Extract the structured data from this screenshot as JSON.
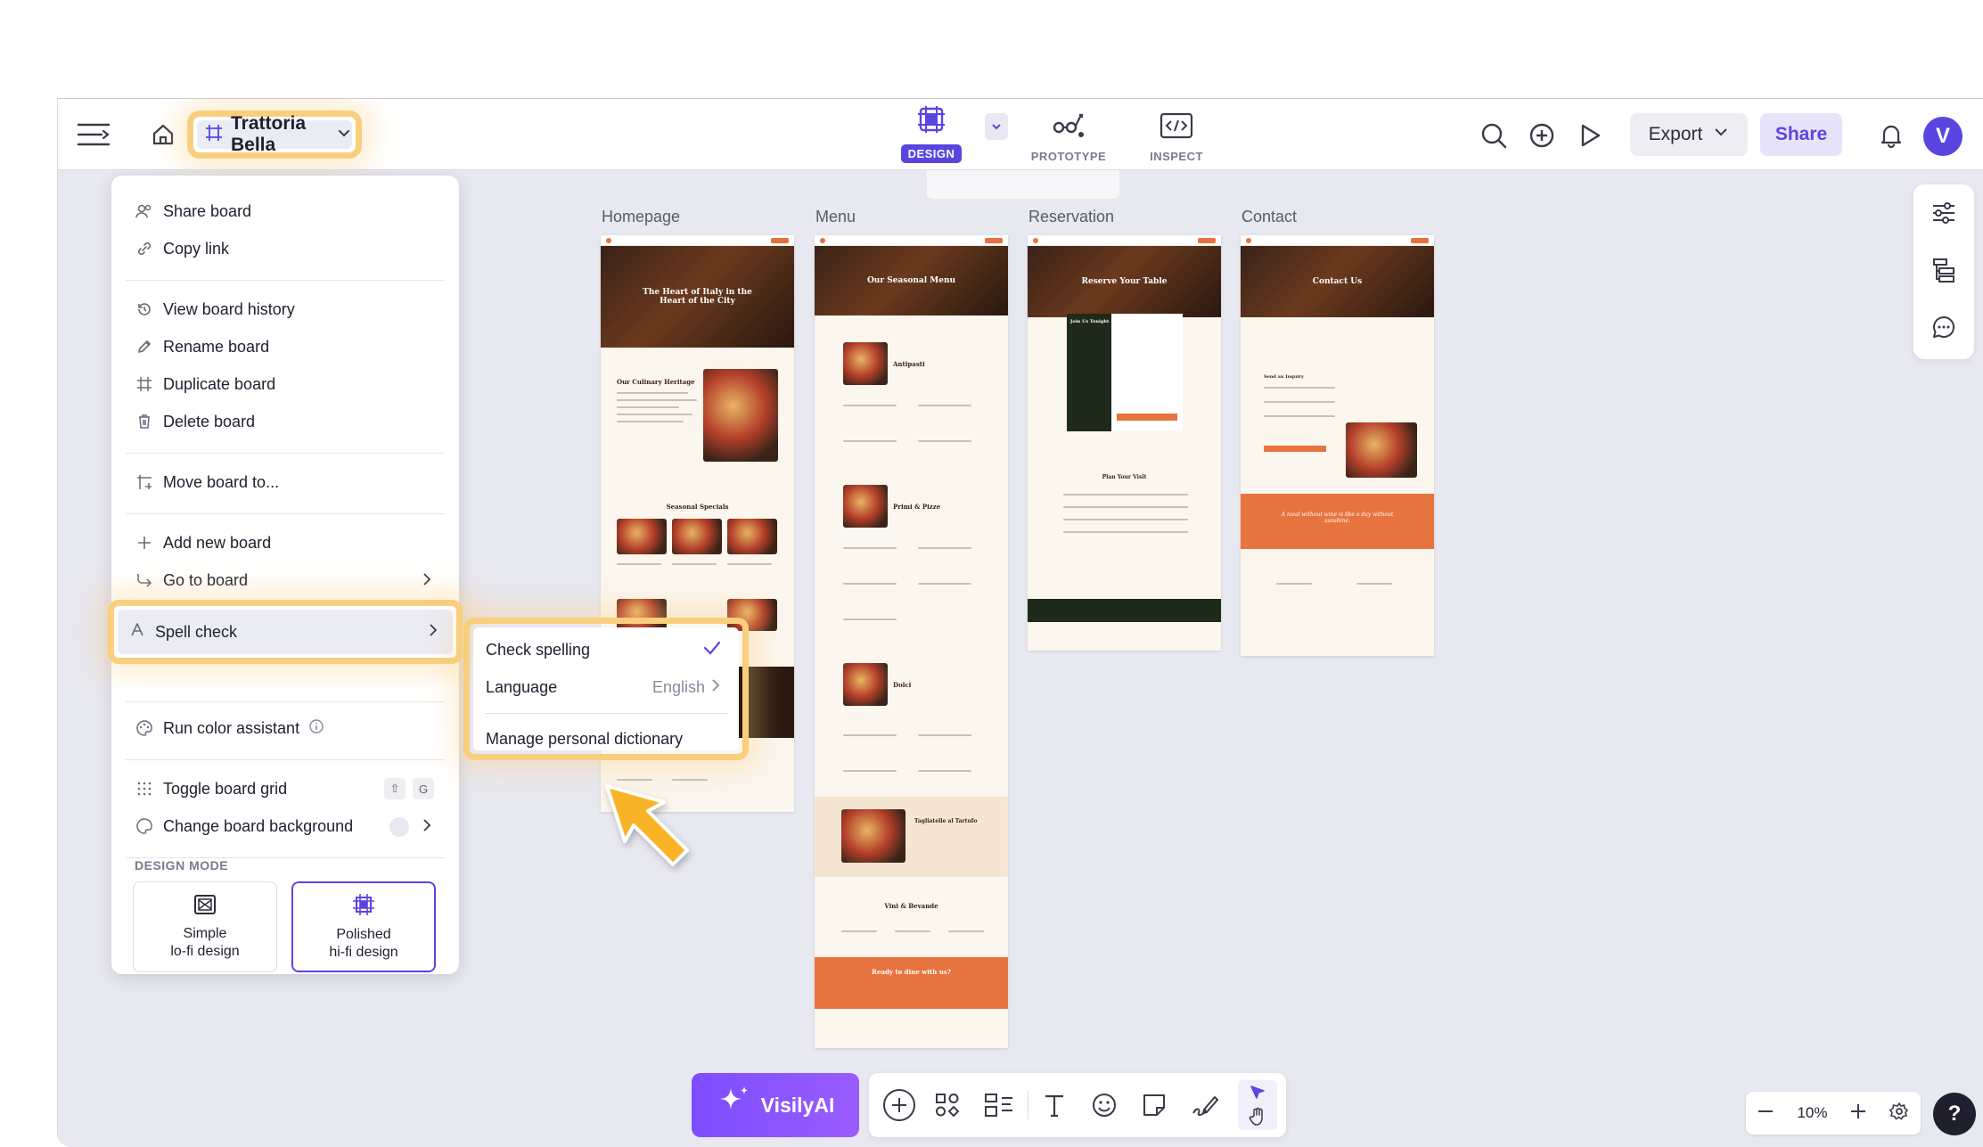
{
  "header": {
    "board_name": "Trattoria Bella",
    "modes": [
      {
        "label": "DESIGN"
      },
      {
        "label": "PROTOTYPE"
      },
      {
        "label": "INSPECT"
      }
    ],
    "export_label": "Export",
    "share_label": "Share",
    "avatar_letter": "V"
  },
  "board_menu": {
    "items": {
      "share_board": "Share board",
      "copy_link": "Copy link",
      "view_history": "View board history",
      "rename": "Rename board",
      "duplicate": "Duplicate board",
      "delete": "Delete board",
      "move": "Move board to...",
      "add_new": "Add new board",
      "go_to": "Go to board",
      "spell_check": "Spell check",
      "color_assistant": "Run color assistant",
      "toggle_grid": "Toggle board grid",
      "change_background": "Change board background"
    },
    "shortcut_keys": [
      "⇧",
      "G"
    ],
    "design_mode_title": "DESIGN MODE",
    "design_modes": [
      {
        "line1": "Simple",
        "line2": "lo-fi design",
        "selected": false
      },
      {
        "line1": "Polished",
        "line2": "hi-fi design",
        "selected": true
      }
    ]
  },
  "spell_submenu": {
    "check_spelling": "Check spelling",
    "check_spelling_checked": true,
    "language_label": "Language",
    "language_value": "English",
    "manage_dictionary": "Manage personal dictionary"
  },
  "canvas": {
    "frames": [
      {
        "label": "Homepage",
        "hero_title": "The Heart of Italy in the Heart of the City",
        "section_1": "Our Culinary Heritage",
        "section_2": "Seasonal Specials"
      },
      {
        "label": "Menu",
        "hero_title": "Our Seasonal Menu",
        "section_1": "Antipasti",
        "section_2": "Primi & Pizze",
        "section_3": "Dolci",
        "section_4": "Tagliatelle al Tartufo",
        "section_5": "Vini & Bevande",
        "cta": "Ready to dine with us?"
      },
      {
        "label": "Reservation",
        "hero_title": "Reserve Your Table",
        "section_1": "Join Us Tonight",
        "section_2": "Plan Your Visit"
      },
      {
        "label": "Contact",
        "hero_title": "Contact Us",
        "section_1": "Send an Inquiry",
        "quote": "A meal without wine is like a day without sunshine."
      }
    ]
  },
  "bottom": {
    "ai_label": "VisilyAI",
    "zoom_value": "10%",
    "help_label": "?"
  },
  "colors": {
    "accent": "#5b45e0",
    "highlight": "#f9cf7e",
    "brand_orange": "#e7743f"
  }
}
